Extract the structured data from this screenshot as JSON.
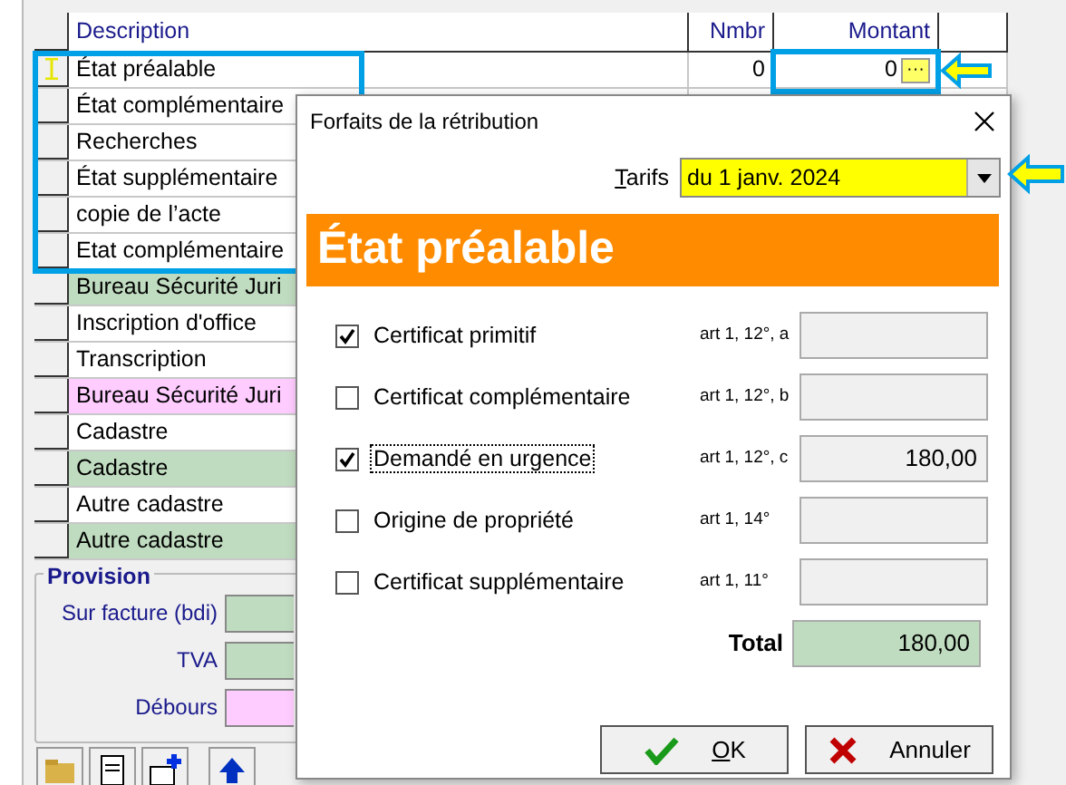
{
  "grid": {
    "columns": [
      "Description",
      "Nmbr",
      "Montant"
    ],
    "rows": [
      {
        "description": "État préalable",
        "nmbr": "0",
        "montant": "0",
        "ellipsis": "···",
        "current": true
      },
      {
        "description": "État complémentaire",
        "current": false
      },
      {
        "description": "Recherches",
        "current": false
      },
      {
        "description": "État supplémentaire",
        "current": false
      },
      {
        "description": "copie de l’acte",
        "current": false
      },
      {
        "description": "Etat complémentaire",
        "current": false
      },
      {
        "description": "Bureau Sécurité Juri",
        "color": "#c0dcc0",
        "current": false
      },
      {
        "description": "Inscription d'office",
        "current": false
      },
      {
        "description": "Transcription",
        "current": false
      },
      {
        "description": "Bureau Sécurité Juri",
        "color": "#ffccff",
        "current": false
      },
      {
        "description": "Cadastre",
        "current": false
      },
      {
        "description": "Cadastre",
        "color": "#c0dcc0",
        "current": false
      },
      {
        "description": "Autre cadastre",
        "current": false
      },
      {
        "description": "Autre cadastre",
        "color": "#c0dcc0",
        "current": false
      }
    ]
  },
  "provision": {
    "title": "Provision",
    "fields": [
      {
        "label": "Sur facture (bdi)",
        "color": "#c0dcc0"
      },
      {
        "label": "TVA",
        "color": "#c0dcc0"
      },
      {
        "label": "Débours",
        "color": "#ffccff"
      }
    ]
  },
  "dialog": {
    "title": "Forfaits de la rétribution",
    "tarifs": {
      "label": "Tarifs",
      "mnemonic": true,
      "value": "du 1 janv. 2024",
      "highlighted": true
    },
    "heading": "État préalable",
    "items": [
      {
        "label": "Certificat primitif",
        "checked": true,
        "focused": false,
        "article": "art 1, 12°, a"
      },
      {
        "label": "Certificat complémentaire",
        "checked": false,
        "focused": false,
        "article": "art 1, 12°, b"
      },
      {
        "label": "Demandé en urgence",
        "checked": true,
        "focused": true,
        "article": "art 1, 12°, c",
        "amount": "180,00"
      },
      {
        "label": "Origine de propriété",
        "checked": false,
        "focused": false,
        "article": "art 1, 14°"
      },
      {
        "label": "Certificat supplémentaire",
        "checked": false,
        "focused": false,
        "article": "art 1, 11°"
      }
    ],
    "total": {
      "label": "Total",
      "value": "180,00"
    },
    "buttons": [
      {
        "label": "OK",
        "kind": "ok",
        "mnemonic": true
      },
      {
        "label": "Annuler",
        "kind": "cancel"
      }
    ]
  }
}
